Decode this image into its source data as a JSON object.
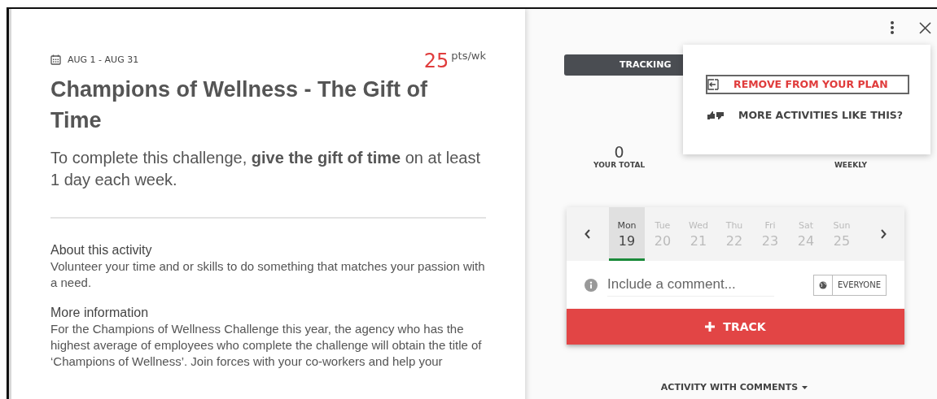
{
  "activity": {
    "dates": "AUG 1 - AUG 31",
    "points": "25",
    "points_unit": "pts/wk",
    "title": "Champions of Wellness - The Gift of Time",
    "description": "To complete this challenge, **give the gift of time** on at least 1 day each week.",
    "sections": [
      {
        "heading": "About this activity",
        "body": "Volunteer your time and or skills to do something that matches your passion with a need."
      },
      {
        "heading": "More information",
        "body": "For the Champions of Wellness Challenge this year, the agency who has the highest average of employees who complete the challenge will obtain the title of ‘Champions of Wellness’. Join forces with your co-workers and help your"
      }
    ]
  },
  "tracking": {
    "tab": "TRACKING",
    "stats": [
      {
        "value": "0",
        "label": "YOUR TOTAL"
      },
      {
        "label": "WEEKLY"
      }
    ]
  },
  "menu": [
    {
      "kind": "remove",
      "label": "REMOVE FROM YOUR PLAN",
      "selected": true
    },
    {
      "kind": "feedback",
      "label": "MORE ACTIVITIES LIKE THIS?",
      "selected": false
    }
  ],
  "days": [
    {
      "name": "Mon",
      "date": "19",
      "selected": true
    },
    {
      "name": "Tue",
      "date": "20",
      "selected": false
    },
    {
      "name": "Wed",
      "date": "21",
      "selected": false
    },
    {
      "name": "Thu",
      "date": "22",
      "selected": false
    },
    {
      "name": "Fri",
      "date": "23",
      "selected": false
    },
    {
      "name": "Sat",
      "date": "24",
      "selected": false
    },
    {
      "name": "Sun",
      "date": "25",
      "selected": false
    }
  ],
  "comment": {
    "placeholder": "Include a comment...",
    "audience": "EVERYONE"
  },
  "track_button": "TRACK",
  "feed_filter": "ACTIVITY WITH COMMENTS"
}
